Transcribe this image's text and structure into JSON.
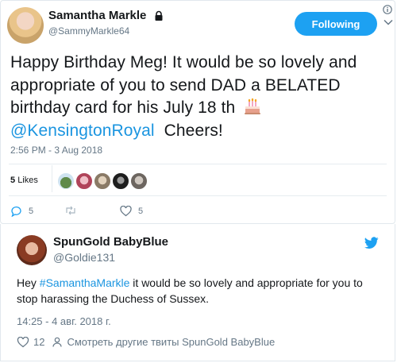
{
  "tweet": {
    "display_name": "Samantha Markle",
    "handle": "@SammyMarkle64",
    "follow_label": "Following",
    "text_before_mention": "Happy Birthday Meg! It would be so lovely and appropriate of you to send DAD a BELATED birthday card for his July 18 th",
    "mention": "@KensingtonRoyal",
    "text_after_mention": "Cheers!",
    "timestamp": "2:56 PM - 3 Aug 2018",
    "likes_count": "5",
    "likes_label": "Likes",
    "reply_count": "5",
    "retweet_count": "",
    "like_count": "5",
    "colors": {
      "accent": "#1da1f2",
      "mention": "#1b95e0",
      "secondary_text": "#657786"
    }
  },
  "reply": {
    "display_name": "SpunGold BabyBlue",
    "handle": "@Goldie131",
    "text_prefix": "Hey ",
    "hashtag": "#SamanthaMarkle",
    "text_suffix": " it would be so lovely and appropriate  for you to stop harassing the Duchess of Sussex.",
    "timestamp": "14:25 - 4 авг. 2018 г.",
    "like_count": "12",
    "more_tweets_label": "Смотреть другие твиты SpunGold BabyBlue"
  }
}
